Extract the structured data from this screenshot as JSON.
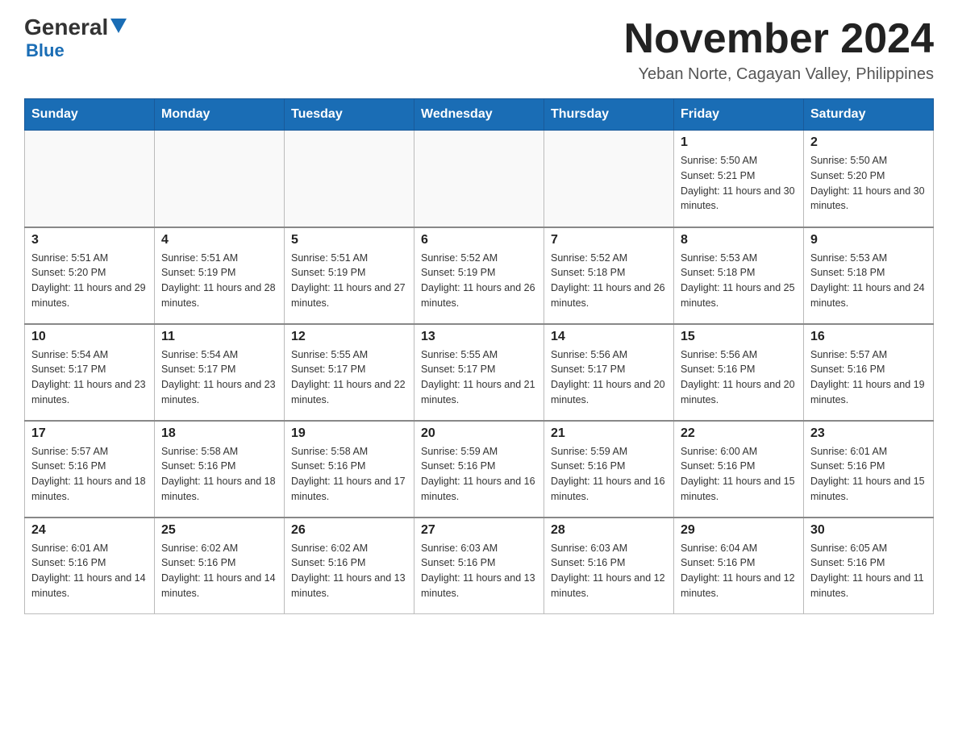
{
  "header": {
    "logo": {
      "general": "General",
      "blue": "Blue",
      "tagline": "Blue"
    },
    "title": "November 2024",
    "subtitle": "Yeban Norte, Cagayan Valley, Philippines"
  },
  "weekdays": [
    "Sunday",
    "Monday",
    "Tuesday",
    "Wednesday",
    "Thursday",
    "Friday",
    "Saturday"
  ],
  "weeks": [
    [
      {
        "day": "",
        "info": ""
      },
      {
        "day": "",
        "info": ""
      },
      {
        "day": "",
        "info": ""
      },
      {
        "day": "",
        "info": ""
      },
      {
        "day": "",
        "info": ""
      },
      {
        "day": "1",
        "info": "Sunrise: 5:50 AM\nSunset: 5:21 PM\nDaylight: 11 hours and 30 minutes."
      },
      {
        "day": "2",
        "info": "Sunrise: 5:50 AM\nSunset: 5:20 PM\nDaylight: 11 hours and 30 minutes."
      }
    ],
    [
      {
        "day": "3",
        "info": "Sunrise: 5:51 AM\nSunset: 5:20 PM\nDaylight: 11 hours and 29 minutes."
      },
      {
        "day": "4",
        "info": "Sunrise: 5:51 AM\nSunset: 5:19 PM\nDaylight: 11 hours and 28 minutes."
      },
      {
        "day": "5",
        "info": "Sunrise: 5:51 AM\nSunset: 5:19 PM\nDaylight: 11 hours and 27 minutes."
      },
      {
        "day": "6",
        "info": "Sunrise: 5:52 AM\nSunset: 5:19 PM\nDaylight: 11 hours and 26 minutes."
      },
      {
        "day": "7",
        "info": "Sunrise: 5:52 AM\nSunset: 5:18 PM\nDaylight: 11 hours and 26 minutes."
      },
      {
        "day": "8",
        "info": "Sunrise: 5:53 AM\nSunset: 5:18 PM\nDaylight: 11 hours and 25 minutes."
      },
      {
        "day": "9",
        "info": "Sunrise: 5:53 AM\nSunset: 5:18 PM\nDaylight: 11 hours and 24 minutes."
      }
    ],
    [
      {
        "day": "10",
        "info": "Sunrise: 5:54 AM\nSunset: 5:17 PM\nDaylight: 11 hours and 23 minutes."
      },
      {
        "day": "11",
        "info": "Sunrise: 5:54 AM\nSunset: 5:17 PM\nDaylight: 11 hours and 23 minutes."
      },
      {
        "day": "12",
        "info": "Sunrise: 5:55 AM\nSunset: 5:17 PM\nDaylight: 11 hours and 22 minutes."
      },
      {
        "day": "13",
        "info": "Sunrise: 5:55 AM\nSunset: 5:17 PM\nDaylight: 11 hours and 21 minutes."
      },
      {
        "day": "14",
        "info": "Sunrise: 5:56 AM\nSunset: 5:17 PM\nDaylight: 11 hours and 20 minutes."
      },
      {
        "day": "15",
        "info": "Sunrise: 5:56 AM\nSunset: 5:16 PM\nDaylight: 11 hours and 20 minutes."
      },
      {
        "day": "16",
        "info": "Sunrise: 5:57 AM\nSunset: 5:16 PM\nDaylight: 11 hours and 19 minutes."
      }
    ],
    [
      {
        "day": "17",
        "info": "Sunrise: 5:57 AM\nSunset: 5:16 PM\nDaylight: 11 hours and 18 minutes."
      },
      {
        "day": "18",
        "info": "Sunrise: 5:58 AM\nSunset: 5:16 PM\nDaylight: 11 hours and 18 minutes."
      },
      {
        "day": "19",
        "info": "Sunrise: 5:58 AM\nSunset: 5:16 PM\nDaylight: 11 hours and 17 minutes."
      },
      {
        "day": "20",
        "info": "Sunrise: 5:59 AM\nSunset: 5:16 PM\nDaylight: 11 hours and 16 minutes."
      },
      {
        "day": "21",
        "info": "Sunrise: 5:59 AM\nSunset: 5:16 PM\nDaylight: 11 hours and 16 minutes."
      },
      {
        "day": "22",
        "info": "Sunrise: 6:00 AM\nSunset: 5:16 PM\nDaylight: 11 hours and 15 minutes."
      },
      {
        "day": "23",
        "info": "Sunrise: 6:01 AM\nSunset: 5:16 PM\nDaylight: 11 hours and 15 minutes."
      }
    ],
    [
      {
        "day": "24",
        "info": "Sunrise: 6:01 AM\nSunset: 5:16 PM\nDaylight: 11 hours and 14 minutes."
      },
      {
        "day": "25",
        "info": "Sunrise: 6:02 AM\nSunset: 5:16 PM\nDaylight: 11 hours and 14 minutes."
      },
      {
        "day": "26",
        "info": "Sunrise: 6:02 AM\nSunset: 5:16 PM\nDaylight: 11 hours and 13 minutes."
      },
      {
        "day": "27",
        "info": "Sunrise: 6:03 AM\nSunset: 5:16 PM\nDaylight: 11 hours and 13 minutes."
      },
      {
        "day": "28",
        "info": "Sunrise: 6:03 AM\nSunset: 5:16 PM\nDaylight: 11 hours and 12 minutes."
      },
      {
        "day": "29",
        "info": "Sunrise: 6:04 AM\nSunset: 5:16 PM\nDaylight: 11 hours and 12 minutes."
      },
      {
        "day": "30",
        "info": "Sunrise: 6:05 AM\nSunset: 5:16 PM\nDaylight: 11 hours and 11 minutes."
      }
    ]
  ]
}
